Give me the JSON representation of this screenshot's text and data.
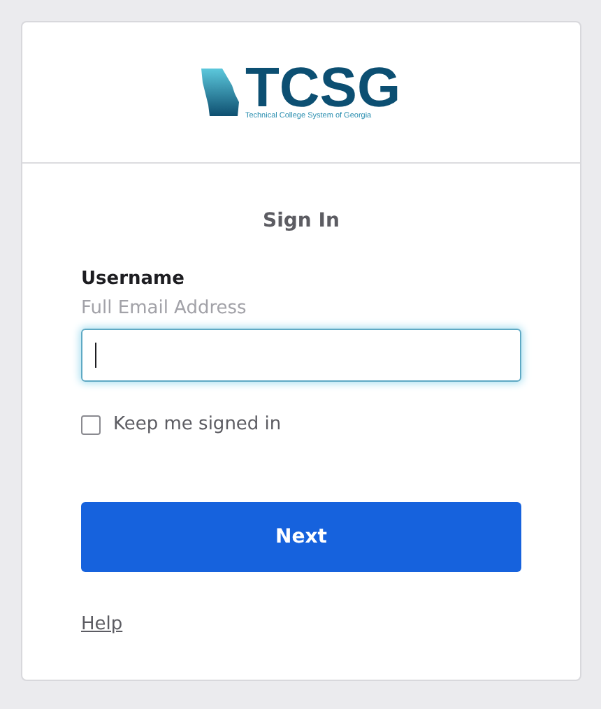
{
  "logo": {
    "wordmark": "TCSG",
    "tagline": "Technical College System of Georgia"
  },
  "title": "Sign In",
  "username": {
    "label": "Username",
    "hint": "Full Email Address",
    "focused": true
  },
  "keep_signed_in": {
    "label": "Keep me signed in",
    "checked": false
  },
  "next_button": "Next",
  "help_link": "Help"
}
